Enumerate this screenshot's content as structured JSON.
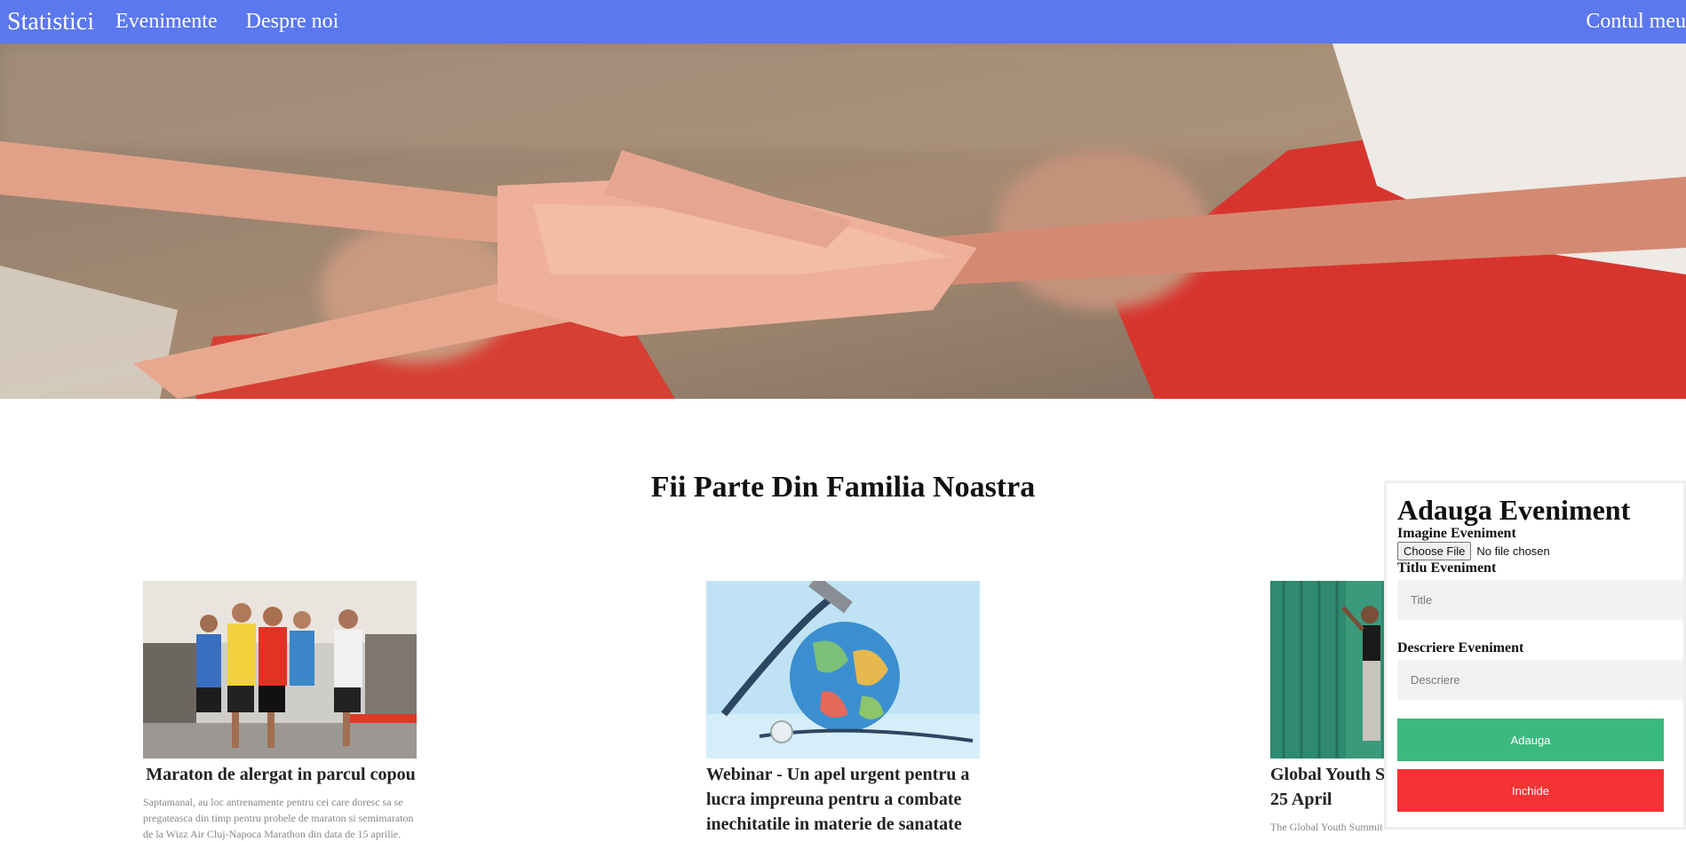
{
  "nav": {
    "brand": "Statistici",
    "links": [
      "Evenimente",
      "Despre noi"
    ],
    "account": "Contul meu"
  },
  "hero": {
    "image": "hands-together-team-photo"
  },
  "section": {
    "title": "Fii Parte Din Familia Noastra"
  },
  "cards": [
    {
      "image": "marathon-runners-photo",
      "title": "Maraton de alergat in parcul copou",
      "description": "Saptamanal, au loc antrenamente pentru cei care doresc sa se pregateasca din timp pentru probele de maraton si semimaraton de la Wizz Air Cluj-Napoca Marathon din data de 15 aprilie."
    },
    {
      "image": "globe-stethoscope-photo",
      "title": "Webinar - Un apel urgent pentru a lucra impreuna pentru a combate inechitatile in materie de sanatate",
      "description": ""
    },
    {
      "image": "youth-summit-photo",
      "title": "Global Youth Summit",
      "title_line2": "25 April",
      "description": "The Global Youth Summit"
    }
  ],
  "modal": {
    "title": "Adauga Eveniment",
    "image_label": "Imagine Eveniment",
    "file_button": "Choose File",
    "file_status": "No file chosen",
    "title_label": "Titlu Eveniment",
    "title_placeholder": "Title",
    "description_label": "Descriere Eveniment",
    "description_placeholder": "Descriere",
    "add_button": "Adauga",
    "close_button": "Inchide"
  },
  "colors": {
    "navbar": "#5b78ee",
    "add_button": "#3cb97e",
    "close_button": "#f53234"
  }
}
